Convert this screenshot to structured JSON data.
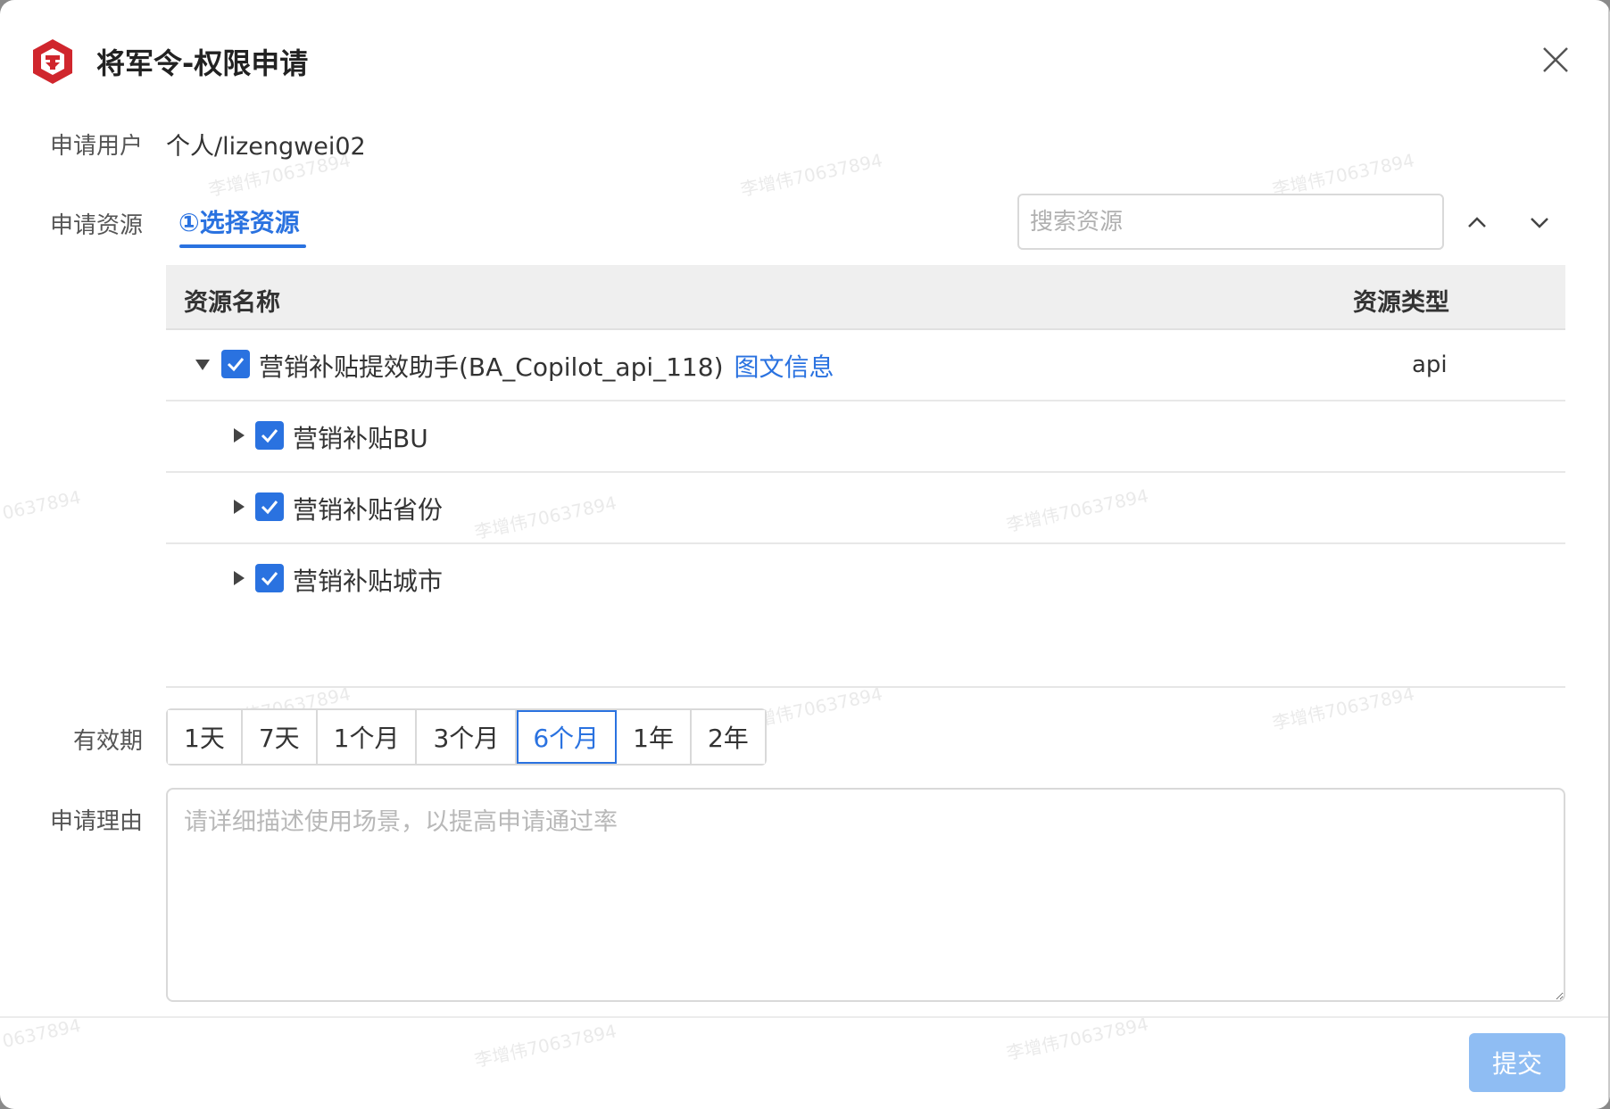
{
  "dialog": {
    "title": "将军令-权限申请",
    "close_icon": "close-icon",
    "brand_color": "#d0262d"
  },
  "applicant": {
    "label": "申请用户",
    "value": "个人/lizengwei02"
  },
  "resource": {
    "label": "申请资源",
    "step_tab": "①选择资源",
    "search_placeholder": "搜索资源",
    "nav_up_icon": "chevron-up-icon",
    "nav_down_icon": "chevron-down-icon"
  },
  "table": {
    "columns": [
      "资源名称",
      "资源类型"
    ],
    "rows": [
      {
        "name": "营销补贴提效助手(BA_Copilot_api_118)",
        "link": "图文信息",
        "type": "api",
        "expanded": true,
        "checked": true,
        "level": 0
      },
      {
        "name": "营销补贴BU",
        "type": "",
        "expanded": false,
        "checked": true,
        "level": 1
      },
      {
        "name": "营销补贴省份",
        "type": "",
        "expanded": false,
        "checked": true,
        "level": 1
      },
      {
        "name": "营销补贴城市",
        "type": "",
        "expanded": false,
        "checked": true,
        "level": 1
      }
    ]
  },
  "period": {
    "label": "有效期",
    "options": [
      "1天",
      "7天",
      "1个月",
      "3个月",
      "6个月",
      "1年",
      "2年"
    ],
    "selected": "6个月"
  },
  "reason": {
    "label": "申请理由",
    "placeholder": "请详细描述使用场景，以提高申请通过率"
  },
  "submit_label": "提交",
  "watermark_text": "李增伟70637894",
  "watermark_text_partial": "0637894",
  "colors": {
    "primary": "#2a72e0",
    "submit_disabled": "#8fbdf3",
    "header_bg": "#efefef"
  }
}
